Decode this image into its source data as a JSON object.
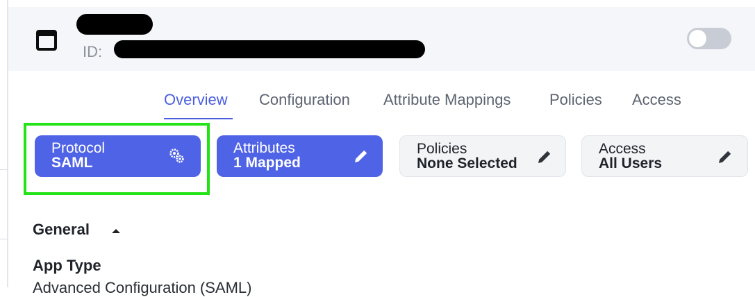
{
  "header": {
    "id_label": "ID:"
  },
  "tabs": [
    {
      "label": "Overview",
      "active": true
    },
    {
      "label": "Configuration",
      "active": false
    },
    {
      "label": "Attribute Mappings",
      "active": false
    },
    {
      "label": "Policies",
      "active": false
    },
    {
      "label": "Access",
      "active": false
    }
  ],
  "cards": {
    "protocol": {
      "title": "Protocol",
      "value": "SAML",
      "icon": "gears-icon"
    },
    "attributes": {
      "title": "Attributes",
      "value": "1 Mapped",
      "icon": "pencil-icon"
    },
    "policies": {
      "title": "Policies",
      "value": "None Selected",
      "icon": "pencil-icon"
    },
    "access": {
      "title": "Access",
      "value": "All Users",
      "icon": "pencil-icon"
    }
  },
  "general": {
    "title": "General",
    "app_type_label": "App Type",
    "app_type_value": "Advanced Configuration (SAML)"
  },
  "colors": {
    "accent": "#4f63e6",
    "highlight": "#22e316",
    "toggle_off": "#c8ccd4"
  }
}
